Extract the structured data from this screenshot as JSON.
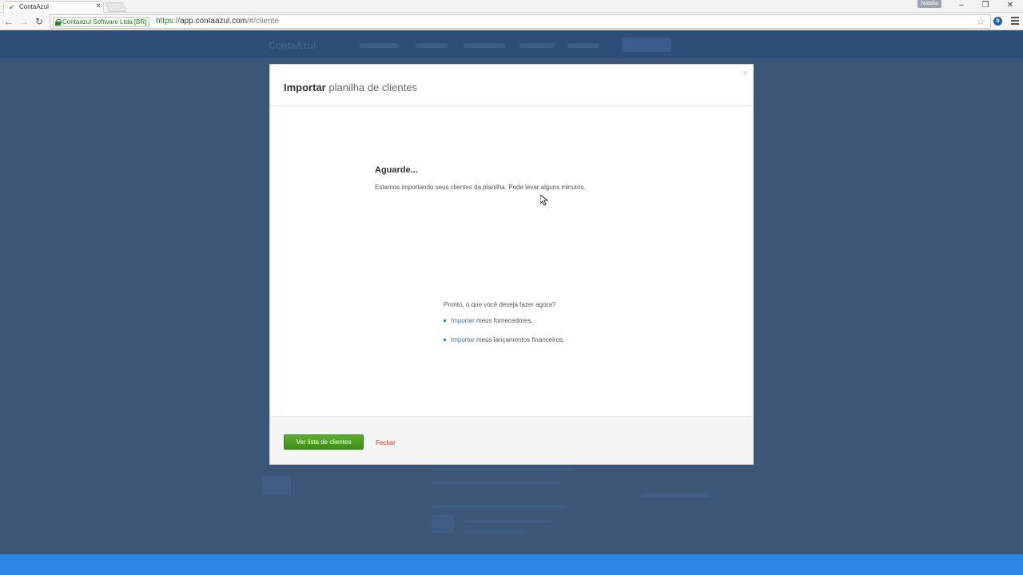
{
  "browser": {
    "tab_title": "ContaAzul",
    "tab_close": "×",
    "user_badge": "Natalia",
    "window_controls": {
      "minimize": "–",
      "restore": "❐",
      "close": "✕"
    },
    "ev_label": "Contaazul Software Ltda [BR]",
    "url_scheme": "https://",
    "url_host": "app.contaazul.com",
    "url_path": "/#/cliente",
    "nav": {
      "back": "←",
      "forward": "→",
      "reload": "↻"
    },
    "extension_badge": "b"
  },
  "app": {
    "logo": "ContaAzul"
  },
  "modal": {
    "title_bold": "Importar",
    "title_rest": " planilha de clientes",
    "close": "×",
    "wait_title": "Aguarde...",
    "wait_text": "Estamos importando seus clientes da planilha. Pode levar alguns minutos.",
    "next_title": "Pronto, o que você deseja fazer agora?",
    "next_items": [
      {
        "link": "Importar",
        "rest": " meus fornecedores."
      },
      {
        "link": "Importar",
        "rest": " meus lançamentos financeiros."
      }
    ],
    "primary_button": "Ver lista de clientes",
    "secondary_button": "Fechar"
  },
  "colors": {
    "primary_button": "#4a9d22",
    "link": "#2a7bc4",
    "danger_link": "#d9342b",
    "overlay": "#3b5677",
    "bottom_bar": "#2a86e0"
  }
}
